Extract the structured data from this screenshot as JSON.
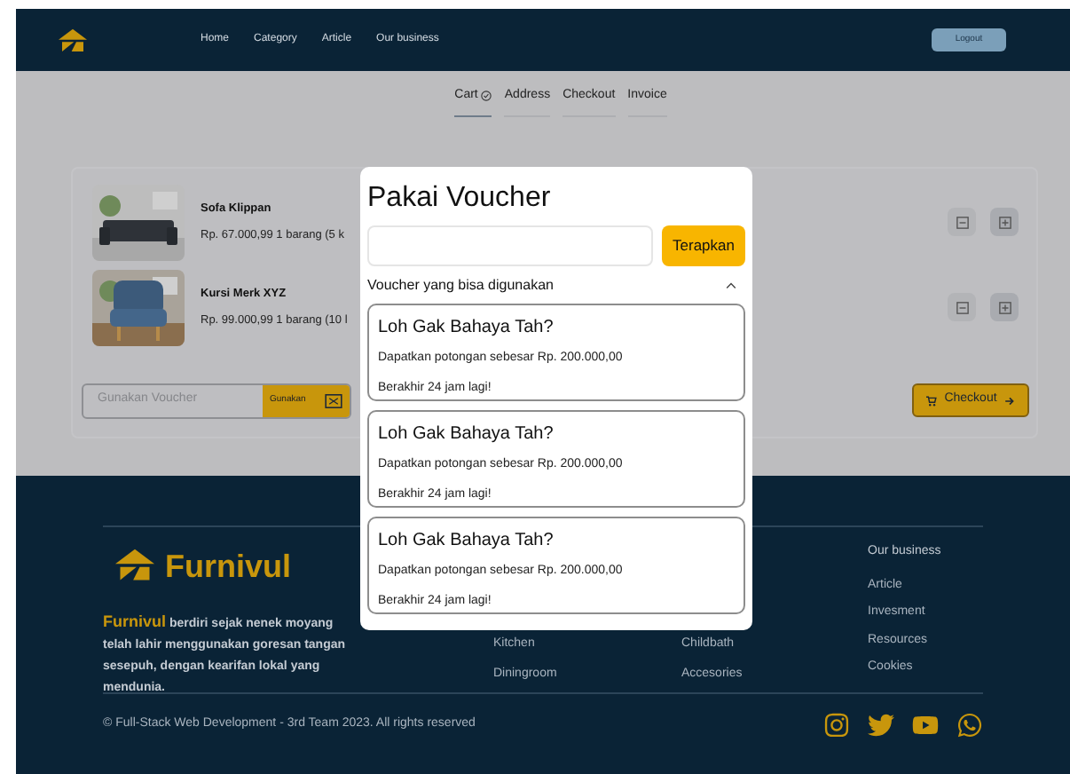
{
  "navbar": {
    "links": [
      "Home",
      "Category",
      "Article",
      "Our business"
    ],
    "logout": "Logout"
  },
  "steps": [
    {
      "label": "Cart",
      "selected": true,
      "completed": true
    },
    {
      "label": "Address",
      "selected": false,
      "completed": false
    },
    {
      "label": "Checkout",
      "selected": false,
      "completed": false
    },
    {
      "label": "Invoice",
      "selected": false,
      "completed": false
    }
  ],
  "cart": {
    "items": [
      {
        "name": "Sofa Klippan",
        "price": "Rp. 67.000,99",
        "quantity": "1 barang (5 k",
        "kind": "picture"
      },
      {
        "name": "Kursi Merk XYZ",
        "price": "Rp. 99.000,99",
        "quantity": "1 barang (10 l",
        "kind": "picture"
      }
    ],
    "voucher_field": {
      "placeholder": "Gunakan Voucher",
      "button": "Gunakan"
    },
    "checkout": "Checkout"
  },
  "modal": {
    "title": "Pakai Voucher",
    "apply": "Terapkan",
    "section": "Voucher yang bisa digunakan",
    "expanded": true,
    "vouchers": [
      {
        "title": "Loh Gak Bahaya Tah?",
        "description": "Dapatkan potongan sebesar Rp. 200.000,00",
        "expiry": "Berakhir 24 jam lagi!"
      },
      {
        "title": "Loh Gak Bahaya Tah?",
        "description": "Dapatkan potongan sebesar Rp. 200.000,00",
        "expiry": "Berakhir 24 jam lagi!"
      },
      {
        "title": "Loh Gak Bahaya Tah?",
        "description": "Dapatkan potongan sebesar Rp. 200.000,00",
        "expiry": "Berakhir 24 jam lagi!"
      }
    ]
  },
  "footer": {
    "brand": "Furnivul",
    "description_brand": "Furnivul",
    "description": "berdiri sejak nenek moyang telah lahir menggunakan goresan tangan sesepuh, dengan kearifan lokal yang mendunia.",
    "column_1": [
      "Kitchen",
      "Diningroom"
    ],
    "column_2": [
      "Childbath",
      "Accesories"
    ],
    "column_3": {
      "heading": "Our business",
      "links": [
        "Article",
        "Invesment",
        "Resources",
        "Cookies"
      ]
    },
    "copyright": "© Full-Stack Web Development  - 3rd Team 2023. All rights reserved"
  }
}
